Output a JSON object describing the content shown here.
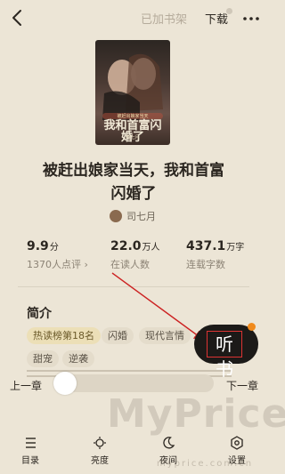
{
  "header": {
    "shelf_label": "已加书架",
    "download_label": "下载"
  },
  "book": {
    "cover": {
      "subtitle": "被赶出娘家当天",
      "title": "我和首富闪婚了",
      "author": "司七月"
    },
    "title_line1": "被赶出娘家当天，我和首富",
    "title_line2": "闪婚了",
    "author": "司七月"
  },
  "stats": [
    {
      "value": "9.9",
      "unit": "分",
      "label": "1370人点评 ›"
    },
    {
      "value": "22.0",
      "unit": "万人",
      "label": "在读人数"
    },
    {
      "value": "437.1",
      "unit": "万字",
      "label": "连载字数"
    }
  ],
  "intro": {
    "heading": "简介",
    "tags": [
      "热读榜第18名",
      "闪婚",
      "现代言情",
      "甜宠",
      "逆袭"
    ]
  },
  "listen_button": {
    "label": "听书"
  },
  "reader_controls": {
    "prev_label": "上一章",
    "next_label": "下一章",
    "progress_fraction": 0.0
  },
  "bottom_bar": [
    {
      "label": "目录",
      "icon": "list-icon"
    },
    {
      "label": "亮度",
      "icon": "brightness-icon"
    },
    {
      "label": "夜间",
      "icon": "moon-icon"
    },
    {
      "label": "设置",
      "icon": "settings-icon"
    }
  ],
  "watermark": {
    "text": "MyPrice",
    "subtext": "myprice.com.cn"
  },
  "colors": {
    "background": "#ece5d6",
    "accent_badge": "#f08a1c",
    "annotation_red": "#cc2222",
    "listen_button_bg": "#1c1a18"
  }
}
